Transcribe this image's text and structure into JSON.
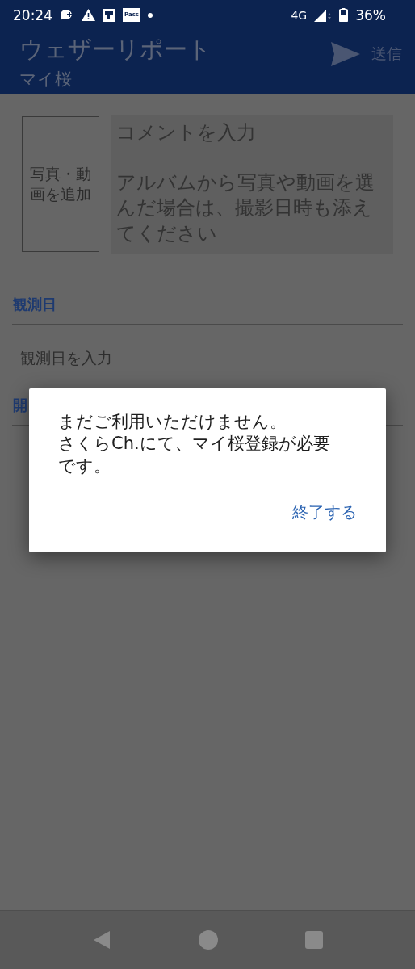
{
  "status_bar": {
    "time": "20:24",
    "pass_badge": "Pass",
    "network": "4G",
    "battery": "36%"
  },
  "app_bar": {
    "title": "ウェザーリポート",
    "subtitle": "マイ桜",
    "send": "送信"
  },
  "photo_button": "写真・動画を追加",
  "comment": {
    "placeholder": "コメントを入力",
    "hint": "アルバムから写真や動画を選んだ場合は、撮影日時も添えてください"
  },
  "sections": [
    {
      "heading": "観測日",
      "placeholder": "観測日を入力"
    },
    {
      "heading": "開"
    }
  ],
  "dialog": {
    "lines": [
      "まだご利用いただけません。",
      "さくらCh.にて、マイ桜登録が必要です。"
    ],
    "button": "終了する"
  }
}
